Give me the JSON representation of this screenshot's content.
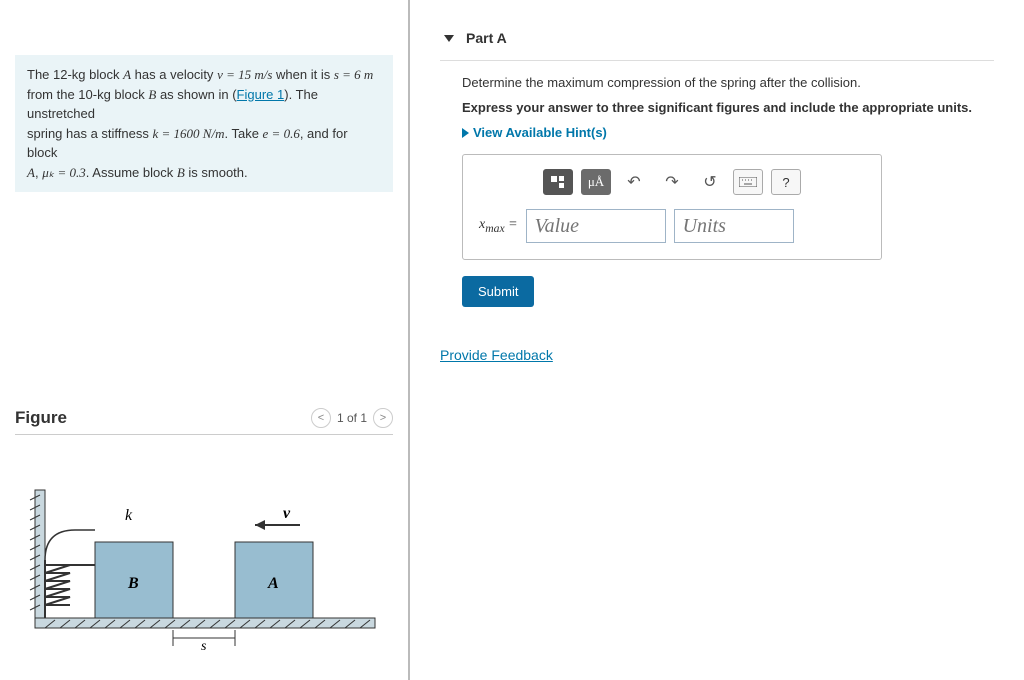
{
  "problem": {
    "text_parts": {
      "p1a": "The 12-kg block ",
      "A": "A",
      "p1b": " has a velocity ",
      "v_eq": "v = 15 m/s",
      "p1c": " when it is ",
      "s_eq": "s = 6 m",
      "p2a": "from the 10-kg block ",
      "B": "B",
      "p2b": " as shown in (",
      "fig_link": "Figure 1",
      "p2c": "). The unstretched",
      "p3a": "spring has a stiffness ",
      "k_eq": "k = 1600 N/m",
      "p3b": ". Take ",
      "e_eq": "e = 0.6",
      "p3c": ", and for block",
      "p4a": "A",
      "p4b": ", ",
      "mu_eq": "μₖ = 0.3",
      "p4c": ". Assume block ",
      "p4d": "B",
      "p4e": " is smooth."
    }
  },
  "figure": {
    "title": "Figure",
    "pager": "1 of 1",
    "labels": {
      "k": "k",
      "v": "v",
      "B": "B",
      "A": "A",
      "s": "s"
    }
  },
  "part": {
    "title": "Part A",
    "question": "Determine the maximum compression of the spring after the collision.",
    "instruction": "Express your answer to three significant figures and include the appropriate units.",
    "hints": "View Available Hint(s)",
    "var_label": "xₘₐₓ =",
    "value_placeholder": "Value",
    "units_placeholder": "Units",
    "toolbar": {
      "units_btn": "μÅ",
      "help": "?"
    },
    "submit": "Submit"
  },
  "feedback": "Provide Feedback"
}
